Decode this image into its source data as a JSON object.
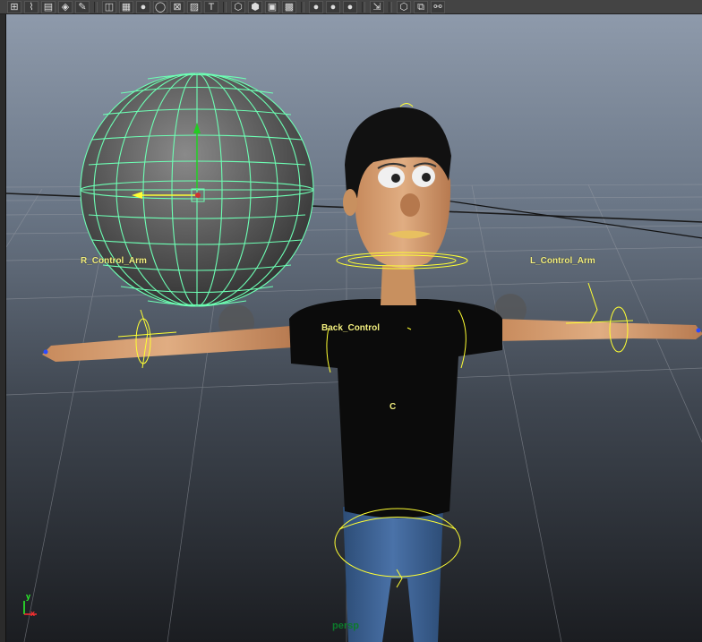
{
  "toolbar": {
    "items": [
      {
        "name": "snap-grid-icon",
        "glyph": "⊞"
      },
      {
        "name": "snap-curve-icon",
        "glyph": "⌇"
      },
      {
        "name": "film-gate-icon",
        "glyph": "▤"
      },
      {
        "name": "camera-attributes-icon",
        "glyph": "◈"
      },
      {
        "name": "bookmark-icon",
        "glyph": "✎"
      },
      {
        "name": "wireframe-icon",
        "glyph": "◫"
      },
      {
        "name": "grid-icon",
        "glyph": "▦"
      },
      {
        "name": "smooth-shade-icon",
        "glyph": "●"
      },
      {
        "name": "shade-icon",
        "glyph": "◯"
      },
      {
        "name": "x-ray-icon",
        "glyph": "⊠"
      },
      {
        "name": "texture-icon",
        "glyph": "▨"
      },
      {
        "name": "text-icon",
        "glyph": "T"
      },
      {
        "name": "cube-wire-icon",
        "glyph": "⬡"
      },
      {
        "name": "cube-shaded-icon",
        "glyph": "⬢"
      },
      {
        "name": "cube-textured-icon",
        "glyph": "▣"
      },
      {
        "name": "checker-icon",
        "glyph": "▩"
      },
      {
        "name": "light-default-icon",
        "glyph": "●"
      },
      {
        "name": "light-all-icon",
        "glyph": "●"
      },
      {
        "name": "light-none-icon",
        "glyph": "●"
      },
      {
        "name": "isolate-select-icon",
        "glyph": "⇲"
      },
      {
        "name": "cube-view-icon",
        "glyph": "⬡"
      },
      {
        "name": "frame-all-icon",
        "glyph": "⧉"
      },
      {
        "name": "share-icon",
        "glyph": "⚯"
      }
    ]
  },
  "viewport": {
    "labels": {
      "r_control_arm": "R_Control_Arm",
      "l_control_arm": "L_Control_Arm",
      "back_control": "Back_Control",
      "center": "C"
    },
    "camera_name": "persp",
    "axis": {
      "y": "y",
      "x": "x"
    }
  },
  "colors": {
    "wireframe": "#6dffb4",
    "control_curve": "#ffff33",
    "label": "#f4f080",
    "skin": "#d59e70",
    "shirt": "#0b0b0b",
    "jeans": "#3a5f91",
    "hair": "#111111"
  }
}
